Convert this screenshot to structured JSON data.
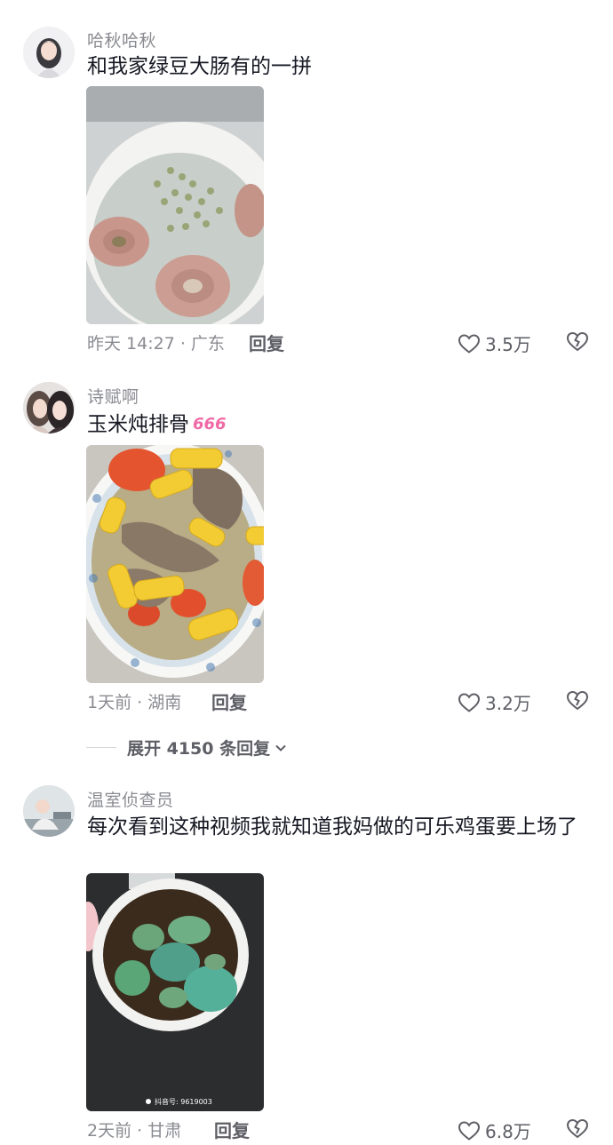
{
  "comments": [
    {
      "username": "哈秋哈秋",
      "text": "和我家绿豆大肠有的一拼",
      "time_location": "昨天 14:27 · 广东",
      "reply_label": "回复",
      "likes": "3.5万",
      "avatar_icon": "girl-avatar-icon",
      "photo_subject": "mung-bean-pork-intestine-soup"
    },
    {
      "username": "诗赋啊",
      "text": "玉米炖排骨",
      "emoji": "666",
      "time_location": "1天前 · 湖南",
      "reply_label": "回复",
      "likes": "3.2万",
      "avatar_icon": "two-girls-avatar-icon",
      "photo_subject": "corn-pork-rib-stew"
    },
    {
      "username": "温室侦查员",
      "text": "每次看到这种视频我就知道我妈做的可乐鸡蛋要上场了",
      "time_location": "2天前 · 甘肃",
      "reply_label": "回复",
      "likes": "6.8万",
      "avatar_icon": "person-avatar-icon",
      "photo_subject": "cola-eggs",
      "photo_watermark": "抖音号: 9619003"
    }
  ],
  "expand_replies": {
    "label": "展开 4150 条回复",
    "icon": "chevron-down-icon"
  },
  "colors": {
    "primary_text": "#161823",
    "secondary_text": "#8a8b91",
    "action_text": "#5e5f66"
  }
}
